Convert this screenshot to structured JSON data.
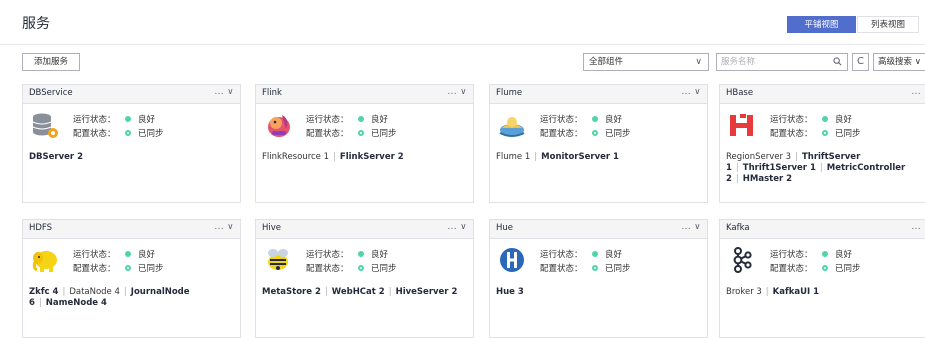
{
  "page": {
    "title": "服务"
  },
  "view_toggle": {
    "tile": "平铺视图",
    "list": "列表视图"
  },
  "toolbar": {
    "add_service": "添加服务",
    "component_filter": "全部组件",
    "search_placeholder": "服务名称",
    "advanced_search": "高级搜索",
    "refresh_glyph": "C"
  },
  "labels": {
    "run_status": "运行状态：",
    "config_status": "配置状态：",
    "menu": "... ∨"
  },
  "colors": {
    "accent": "#526ecc",
    "good": "#50d4ab"
  },
  "services": [
    {
      "name": "DBService",
      "icon": "database-gear-icon",
      "run": "良好",
      "config": "已同步",
      "roles": [
        {
          "text": "DBServer 2",
          "bold": true
        }
      ]
    },
    {
      "name": "Flink",
      "icon": "flink-squirrel-icon",
      "run": "良好",
      "config": "已同步",
      "roles": [
        {
          "text": "FlinkResource 1",
          "bold": false
        },
        {
          "text": "FlinkServer 2",
          "bold": true
        }
      ]
    },
    {
      "name": "Flume",
      "icon": "flume-icon",
      "run": "良好",
      "config": "已同步",
      "roles": [
        {
          "text": "Flume 1",
          "bold": false
        },
        {
          "text": "MonitorServer 1",
          "bold": true
        }
      ]
    },
    {
      "name": "HBase",
      "icon": "hbase-icon",
      "run": "良好",
      "config": "已同步",
      "roles": [
        {
          "text": "RegionServer 3",
          "bold": false
        },
        {
          "text": "ThriftServer 1",
          "bold": true
        },
        {
          "text": "Thrift1Server 1",
          "bold": true
        },
        {
          "text": "MetricController 2",
          "bold": true
        },
        {
          "text": "HMaster 2",
          "bold": true
        }
      ]
    },
    {
      "name": "HDFS",
      "icon": "hdfs-elephant-icon",
      "run": "良好",
      "config": "已同步",
      "roles": [
        {
          "text": "Zkfc 4",
          "bold": true
        },
        {
          "text": "DataNode 4",
          "bold": false
        },
        {
          "text": "JournalNode 6",
          "bold": true
        },
        {
          "text": "NameNode 4",
          "bold": true
        }
      ]
    },
    {
      "name": "Hive",
      "icon": "hive-bee-icon",
      "run": "良好",
      "config": "已同步",
      "roles": [
        {
          "text": "MetaStore 2",
          "bold": true
        },
        {
          "text": "WebHCat 2",
          "bold": true
        },
        {
          "text": "HiveServer 2",
          "bold": true
        }
      ]
    },
    {
      "name": "Hue",
      "icon": "hue-icon",
      "run": "良好",
      "config": "已同步",
      "roles": [
        {
          "text": "Hue 3",
          "bold": true
        }
      ]
    },
    {
      "name": "Kafka",
      "icon": "kafka-icon",
      "run": "良好",
      "config": "已同步",
      "roles": [
        {
          "text": "Broker 3",
          "bold": false
        },
        {
          "text": "KafkaUI 1",
          "bold": true
        }
      ]
    }
  ]
}
